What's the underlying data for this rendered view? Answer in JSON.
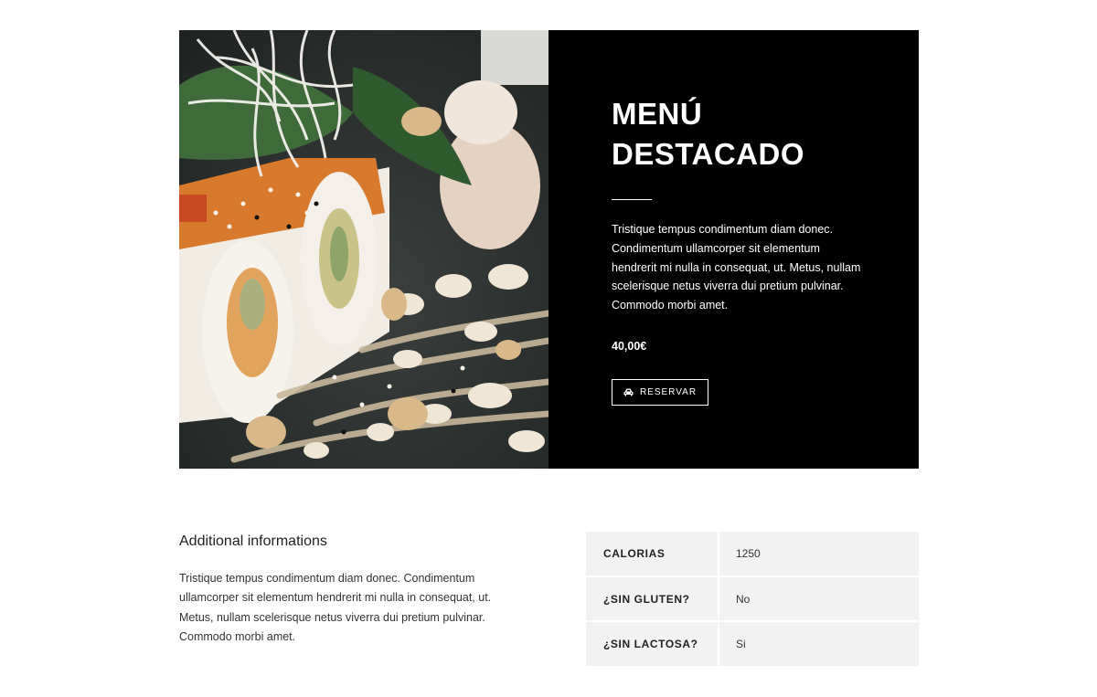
{
  "featured": {
    "title_line1": "MENÚ",
    "title_line2": "DESTACADO",
    "description": "Tristique tempus condimentum diam donec. Condimentum ullamcorper sit elementum hendrerit mi nulla in consequat, ut. Metus, nullam scelerisque netus viverra dui pretium pulvinar. Commodo morbi amet.",
    "price": "40,00€",
    "button_label": "RESERVAR",
    "button_icon": "car-icon"
  },
  "additional": {
    "heading": "Additional informations",
    "text": "Tristique tempus condimentum diam donec. Condimentum ullamcorper sit elementum hendrerit mi nulla in consequat, ut. Metus, nullam scelerisque netus viverra dui pretium pulvinar. Commodo morbi amet."
  },
  "specs": [
    {
      "label": "CALORIAS",
      "value": "1250"
    },
    {
      "label": "¿SIN GLUTEN?",
      "value": "No"
    },
    {
      "label": "¿SIN LACTOSA?",
      "value": "Si"
    }
  ],
  "colors": {
    "panel_bg": "#000000",
    "table_bg": "#f2f2f2",
    "text": "#222222"
  }
}
